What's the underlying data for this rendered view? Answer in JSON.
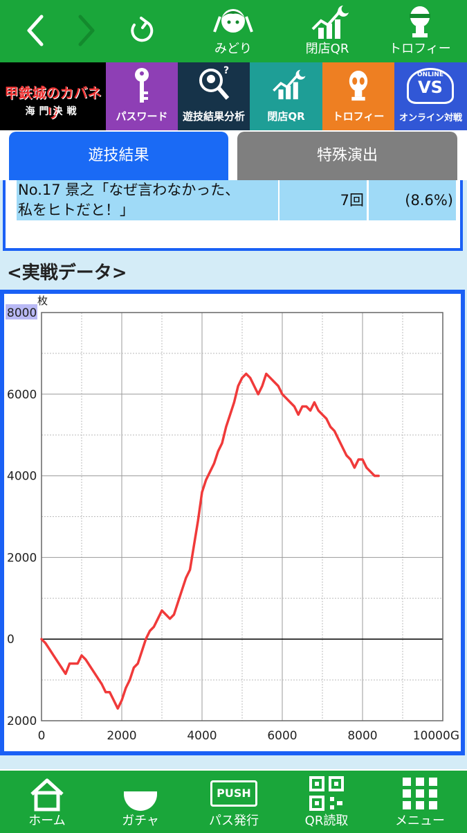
{
  "topnav": {
    "items": [
      {
        "label": "みどり"
      },
      {
        "label": "閉店QR"
      },
      {
        "label": "トロフィー"
      }
    ]
  },
  "category_bar": {
    "logo_text": "甲鉄城のカバネリ",
    "logo_subtext": "海門決戦",
    "items": [
      {
        "label": "パスワード",
        "color": "#8e3fb5",
        "icon": "key-icon"
      },
      {
        "label": "遊技結果分析",
        "color": "#163349",
        "icon": "analysis-icon"
      },
      {
        "label": "閉店QR",
        "color": "#1e9e96",
        "icon": "chart-moon-icon"
      },
      {
        "label": "トロフィー",
        "color": "#ee7f22",
        "icon": "trophy-alien-icon"
      },
      {
        "label": "オンライン対戦",
        "color": "#3157d6",
        "icon": "vs-icon",
        "badge": "ONLINE",
        "badge_main": "VS"
      }
    ]
  },
  "tabs": [
    {
      "label": "遊技結果",
      "active": true
    },
    {
      "label": "特殊演出",
      "active": false
    }
  ],
  "result_row": {
    "name_line1": "No.17 景之「なぜ言わなかった、",
    "name_line2": "私をヒトだと！」",
    "count": "7回",
    "percent": "(8.6%)"
  },
  "section": {
    "title": "<実戦データ>"
  },
  "chart_data": {
    "type": "line",
    "ylabel": "枚",
    "xunit": "G",
    "xlim": [
      0,
      10000
    ],
    "ylim": [
      -2000,
      8000
    ],
    "xticks": [
      "0",
      "2000",
      "4000",
      "6000",
      "8000",
      "10000G"
    ],
    "yticks": [
      "8000",
      "6000",
      "4000",
      "2000",
      "0",
      "2000"
    ],
    "grid": true,
    "series": [
      {
        "color": "#f03a3a",
        "x": [
          0,
          100,
          200,
          300,
          400,
          500,
          600,
          700,
          800,
          900,
          1000,
          1100,
          1200,
          1300,
          1400,
          1500,
          1600,
          1700,
          1800,
          1900,
          2000,
          2100,
          2200,
          2300,
          2400,
          2500,
          2600,
          2700,
          2800,
          2900,
          3000,
          3100,
          3200,
          3300,
          3400,
          3500,
          3600,
          3700,
          3800,
          3900,
          4000,
          4100,
          4200,
          4300,
          4400,
          4500,
          4600,
          4700,
          4800,
          4900,
          5000,
          5100,
          5200,
          5300,
          5400,
          5500,
          5600,
          5700,
          5800,
          5900,
          6000,
          6100,
          6200,
          6300,
          6400,
          6500,
          6600,
          6700,
          6800,
          6900,
          7000,
          7100,
          7200,
          7300,
          7400,
          7500,
          7600,
          7700,
          7800,
          7900,
          8000,
          8100,
          8200,
          8300,
          8400
        ],
        "y": [
          0,
          -100,
          -250,
          -400,
          -550,
          -700,
          -850,
          -600,
          -600,
          -600,
          -400,
          -500,
          -650,
          -800,
          -950,
          -1100,
          -1300,
          -1300,
          -1500,
          -1700,
          -1500,
          -1200,
          -1000,
          -700,
          -600,
          -300,
          0,
          200,
          300,
          500,
          700,
          600,
          500,
          600,
          900,
          1200,
          1500,
          1700,
          2300,
          2900,
          3600,
          3900,
          4100,
          4300,
          4600,
          4800,
          5200,
          5500,
          5800,
          6200,
          6400,
          6500,
          6400,
          6200,
          6000,
          6200,
          6500,
          6400,
          6300,
          6200,
          6000,
          5900,
          5800,
          5700,
          5500,
          5700,
          5700,
          5600,
          5800,
          5600,
          5500,
          5400,
          5200,
          5100,
          4900,
          4700,
          4500,
          4400,
          4200,
          4400,
          4400,
          4200,
          4100,
          4000,
          4000
        ]
      }
    ]
  },
  "bottomnav": {
    "items": [
      {
        "label": "ホーム"
      },
      {
        "label": "ガチャ"
      },
      {
        "label": "パス発行",
        "badge": "PUSH"
      },
      {
        "label": "QR読取"
      },
      {
        "label": "メニュー"
      }
    ]
  }
}
